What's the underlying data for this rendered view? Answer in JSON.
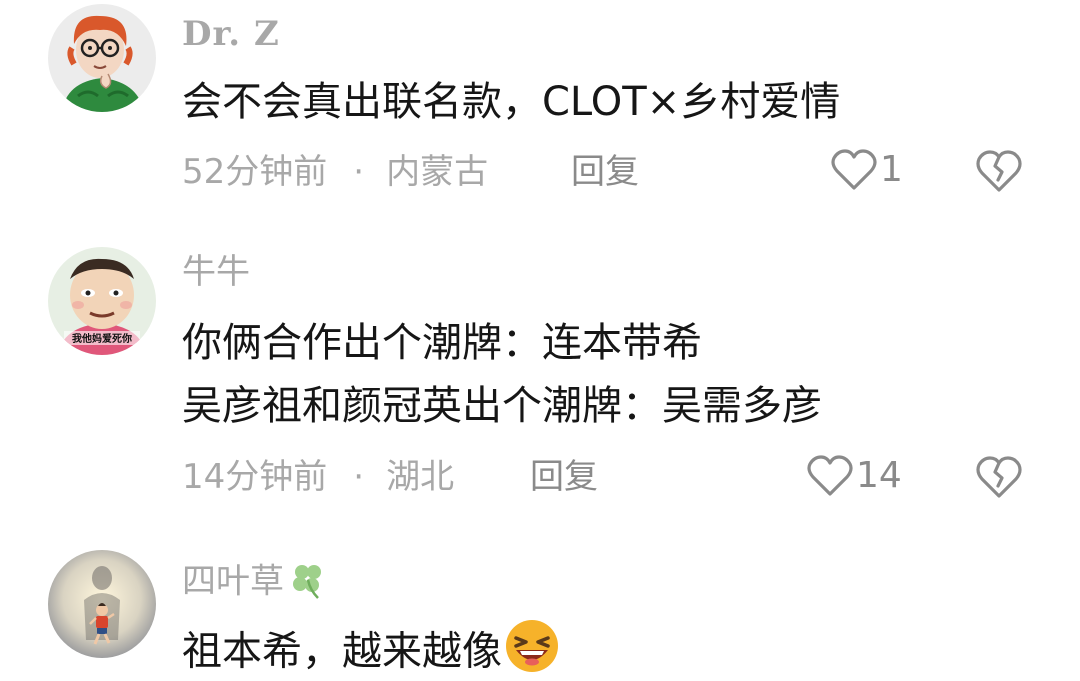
{
  "comments": [
    {
      "username": "Dr. Z",
      "lines": [
        "会不会真出联名款，CLOT×乡村爱情"
      ],
      "time": "52分钟前",
      "separator": "·",
      "location": "内蒙古",
      "reply_label": "回复",
      "likes": "1",
      "avatar_icon": "cartoon-man-glasses-avatar",
      "username_emoji": ""
    },
    {
      "username": "牛牛",
      "lines": [
        "你俩合作出个潮牌：连本带希",
        "吴彦祖和颜冠英出个潮牌：吴需多彦"
      ],
      "time": "14分钟前",
      "separator": "·",
      "location": "湖北",
      "reply_label": "回复",
      "likes": "14",
      "avatar_icon": "meme-face-avatar",
      "avatar_caption": "我他妈爱死你"
    },
    {
      "username": "四叶草",
      "username_emoji": "four-leaf-clover-icon",
      "lines": [
        "祖本希，越来越像"
      ],
      "line_emoji": "laughing-emoji-icon",
      "avatar_icon": "running-child-avatar"
    }
  ],
  "colors": {
    "text_primary": "#161616",
    "text_secondary": "#a8a8a8",
    "icon_gray": "#8a8a8a"
  }
}
